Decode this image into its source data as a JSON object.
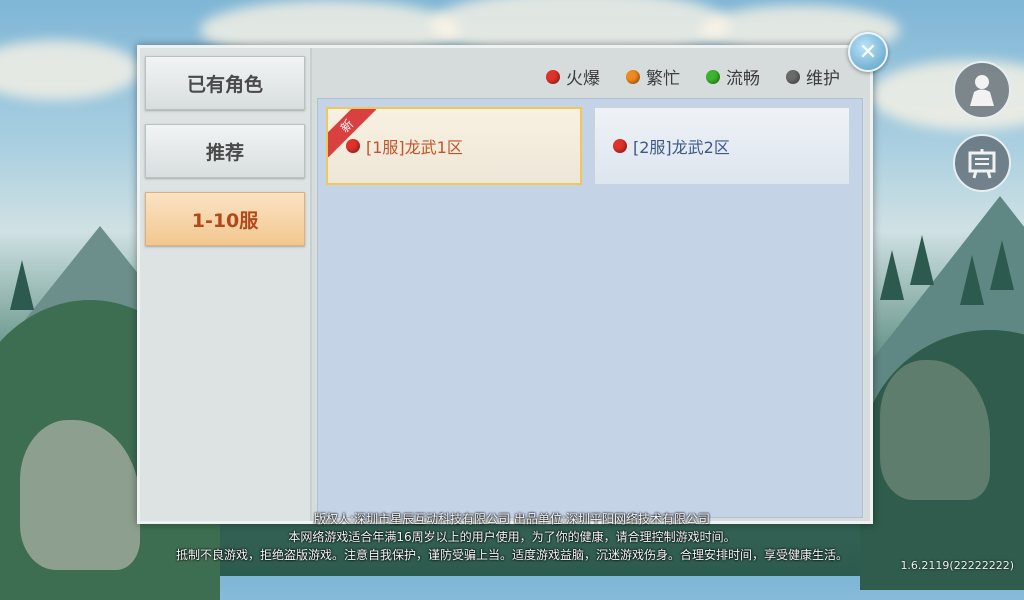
{
  "sidebar": {
    "items": [
      {
        "label": "已有角色",
        "active": false
      },
      {
        "label": "推荐",
        "active": false
      },
      {
        "label": "1-10服",
        "active": true
      }
    ]
  },
  "legend": [
    {
      "label": "火爆",
      "color": "#e0322a"
    },
    {
      "label": "繁忙",
      "color": "#f08a1c"
    },
    {
      "label": "流畅",
      "color": "#3cb52e"
    },
    {
      "label": "维护",
      "color": "#6a6a6a"
    }
  ],
  "servers": [
    {
      "name": "[1服]龙武1区",
      "status_color": "#e0322a",
      "badge": "新",
      "selected": true
    },
    {
      "name": "[2服]龙武2区",
      "status_color": "#e0322a",
      "badge": "",
      "selected": false
    }
  ],
  "footer": {
    "line1": "版权人:深圳市星辰互动科技有限公司  出品单位:深圳平阳网络技术有限公司",
    "line2": "本网络游戏适合年满16周岁以上的用户使用，为了你的健康，请合理控制游戏时间。",
    "line3": "抵制不良游戏，拒绝盗版游戏。注意自我保护，谨防受骗上当。适度游戏益脑，沉迷游戏伤身。合理安排时间，享受健康生活。"
  },
  "version": "1.6.2119(22222222)",
  "icons": {
    "close": "close-icon",
    "character": "character-icon",
    "notice": "notice-board-icon"
  }
}
